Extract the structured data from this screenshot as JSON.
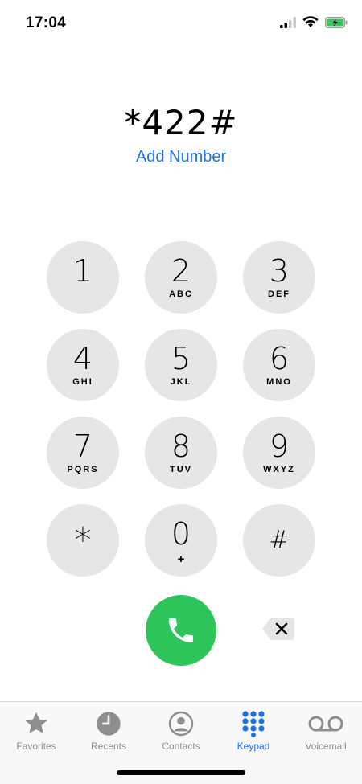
{
  "status_bar": {
    "time": "17:04"
  },
  "dialer": {
    "entered_number": "*422#",
    "add_number_label": "Add Number"
  },
  "keypad": {
    "keys": [
      {
        "digit": "1",
        "letters": ""
      },
      {
        "digit": "2",
        "letters": "ABC"
      },
      {
        "digit": "3",
        "letters": "DEF"
      },
      {
        "digit": "4",
        "letters": "GHI"
      },
      {
        "digit": "5",
        "letters": "JKL"
      },
      {
        "digit": "6",
        "letters": "MNO"
      },
      {
        "digit": "7",
        "letters": "PQRS"
      },
      {
        "digit": "8",
        "letters": "TUV"
      },
      {
        "digit": "9",
        "letters": "WXYZ"
      },
      {
        "digit": "*",
        "letters": ""
      },
      {
        "digit": "0",
        "letters": "+"
      },
      {
        "digit": "#",
        "letters": ""
      }
    ]
  },
  "tab_bar": {
    "active": "Keypad",
    "tabs": [
      {
        "label": "Favorites",
        "icon": "star-icon"
      },
      {
        "label": "Recents",
        "icon": "clock-icon"
      },
      {
        "label": "Contacts",
        "icon": "person-icon"
      },
      {
        "label": "Keypad",
        "icon": "keypad-grid-icon"
      },
      {
        "label": "Voicemail",
        "icon": "voicemail-icon"
      }
    ]
  },
  "colors": {
    "accent": "#1a73e8",
    "call_green": "#2dc45a",
    "key_gray": "#e6e6e6",
    "battery_green": "#34c759"
  }
}
